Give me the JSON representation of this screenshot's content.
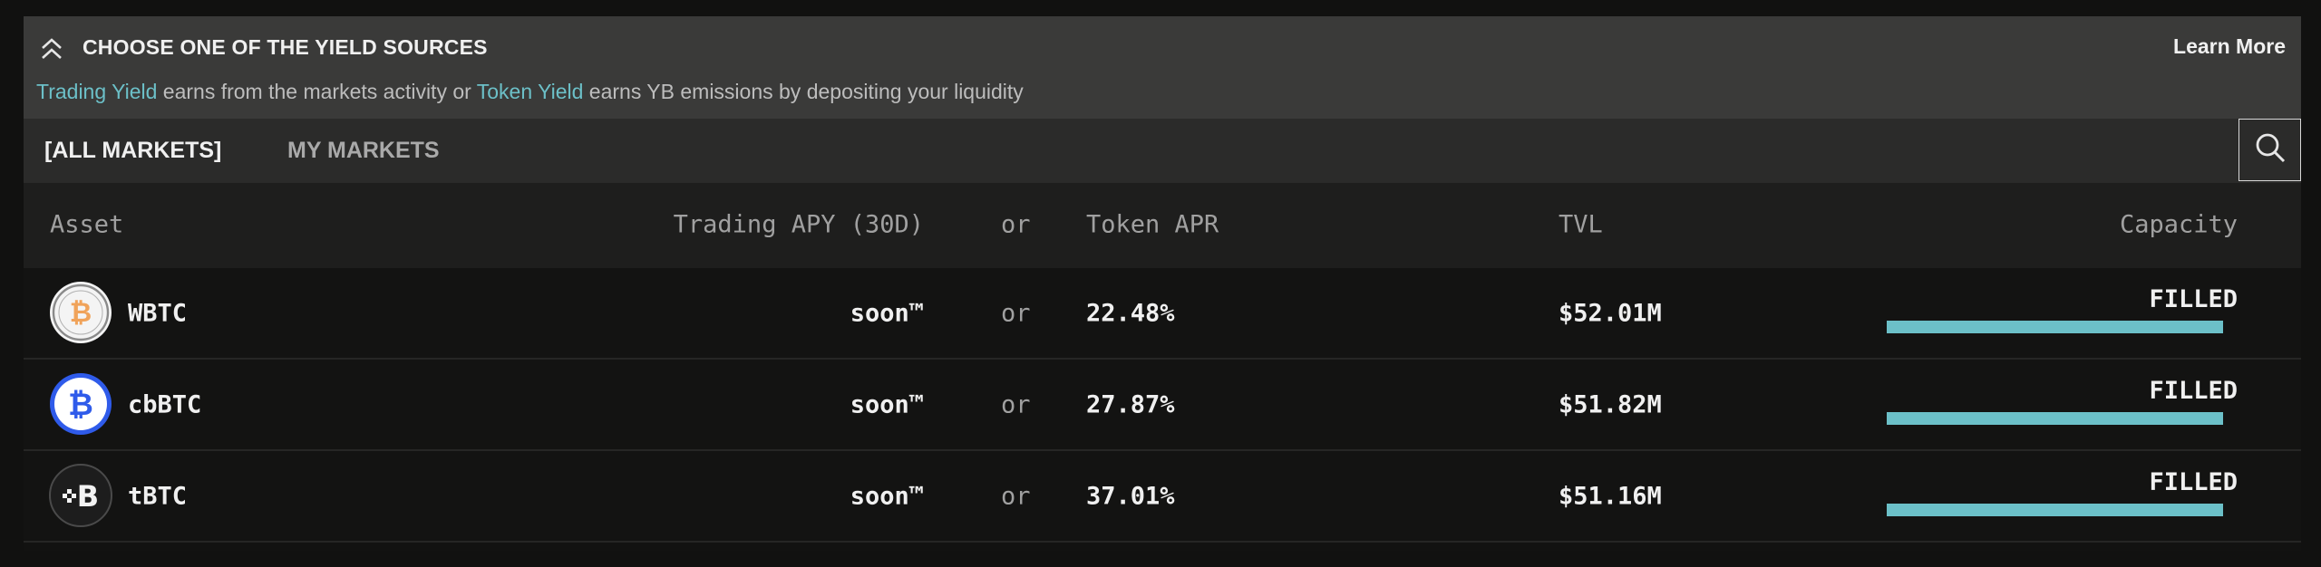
{
  "banner": {
    "title": "CHOOSE ONE OF THE YIELD SOURCES",
    "learn_more": "Learn More",
    "desc_link1": "Trading Yield",
    "desc_mid": " earns from the markets activity or ",
    "desc_link2": "Token Yield",
    "desc_end": " earns YB emissions by depositing your liquidity"
  },
  "tabs": {
    "all": "[ALL MARKETS]",
    "my": "MY MARKETS"
  },
  "table": {
    "headers": {
      "asset": "Asset",
      "trading": "Trading APY (30D)",
      "or": "or",
      "token": "Token APR",
      "tvl": "TVL",
      "capacity": "Capacity"
    },
    "rows": [
      {
        "asset": "WBTC",
        "trading": "soon™",
        "or": "or",
        "apr": "22.48%",
        "tvl": "$52.01M",
        "capacity": "FILLED",
        "capacity_fill": 1.0,
        "icon": "wbtc-icon"
      },
      {
        "asset": "cbBTC",
        "trading": "soon™",
        "or": "or",
        "apr": "27.87%",
        "tvl": "$51.82M",
        "capacity": "FILLED",
        "capacity_fill": 1.0,
        "icon": "cbbtc-icon"
      },
      {
        "asset": "tBTC",
        "trading": "soon™",
        "or": "or",
        "apr": "37.01%",
        "tvl": "$51.16M",
        "capacity": "FILLED",
        "capacity_fill": 1.0,
        "icon": "tbtc-icon"
      }
    ]
  },
  "colors": {
    "accent": "#6cc0c8",
    "banner_bg": "#3a3a39",
    "tabs_bg": "#2b2b2a",
    "header_bg": "#1e1e1d",
    "row_bg": "#131312",
    "wbtc_orange": "#f0a35a",
    "cbbtc_blue": "#2f5bea"
  }
}
